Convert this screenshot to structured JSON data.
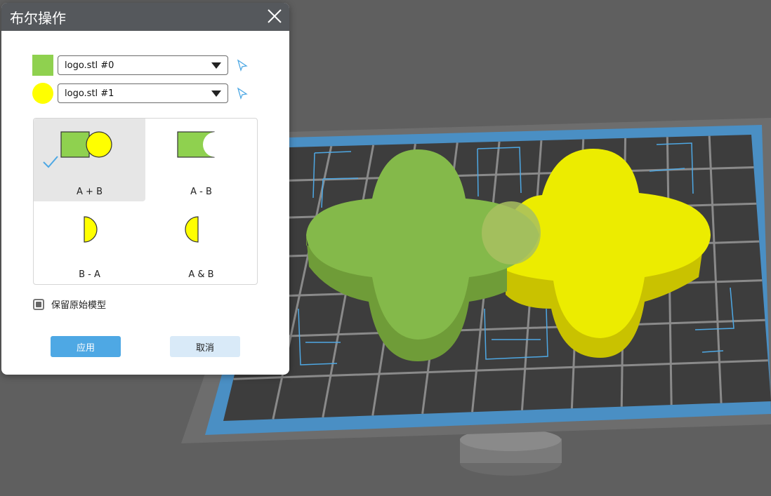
{
  "dialog": {
    "title": "布尔操作",
    "model_a": {
      "value": "logo.stl #0",
      "color": "#8fd14f"
    },
    "model_b": {
      "value": "logo.stl #1",
      "color": "#ffff00"
    },
    "operations": [
      {
        "label": "A + B",
        "selected": true
      },
      {
        "label": "A - B",
        "selected": false
      },
      {
        "label": "B - A",
        "selected": false
      },
      {
        "label": "A & B",
        "selected": false
      }
    ],
    "keep_original_label": "保留原始模型",
    "keep_original_checked": true,
    "apply_label": "应用",
    "cancel_label": "取消"
  },
  "scene": {
    "bed_frame_color": "#6d6d6d",
    "bed_border_color": "#4a8fc4",
    "bed_surface_color": "#3d3d3d",
    "model_a_color": "#84b94a",
    "model_b_color": "#e8e800",
    "accent_color": "#4ea8e4"
  }
}
